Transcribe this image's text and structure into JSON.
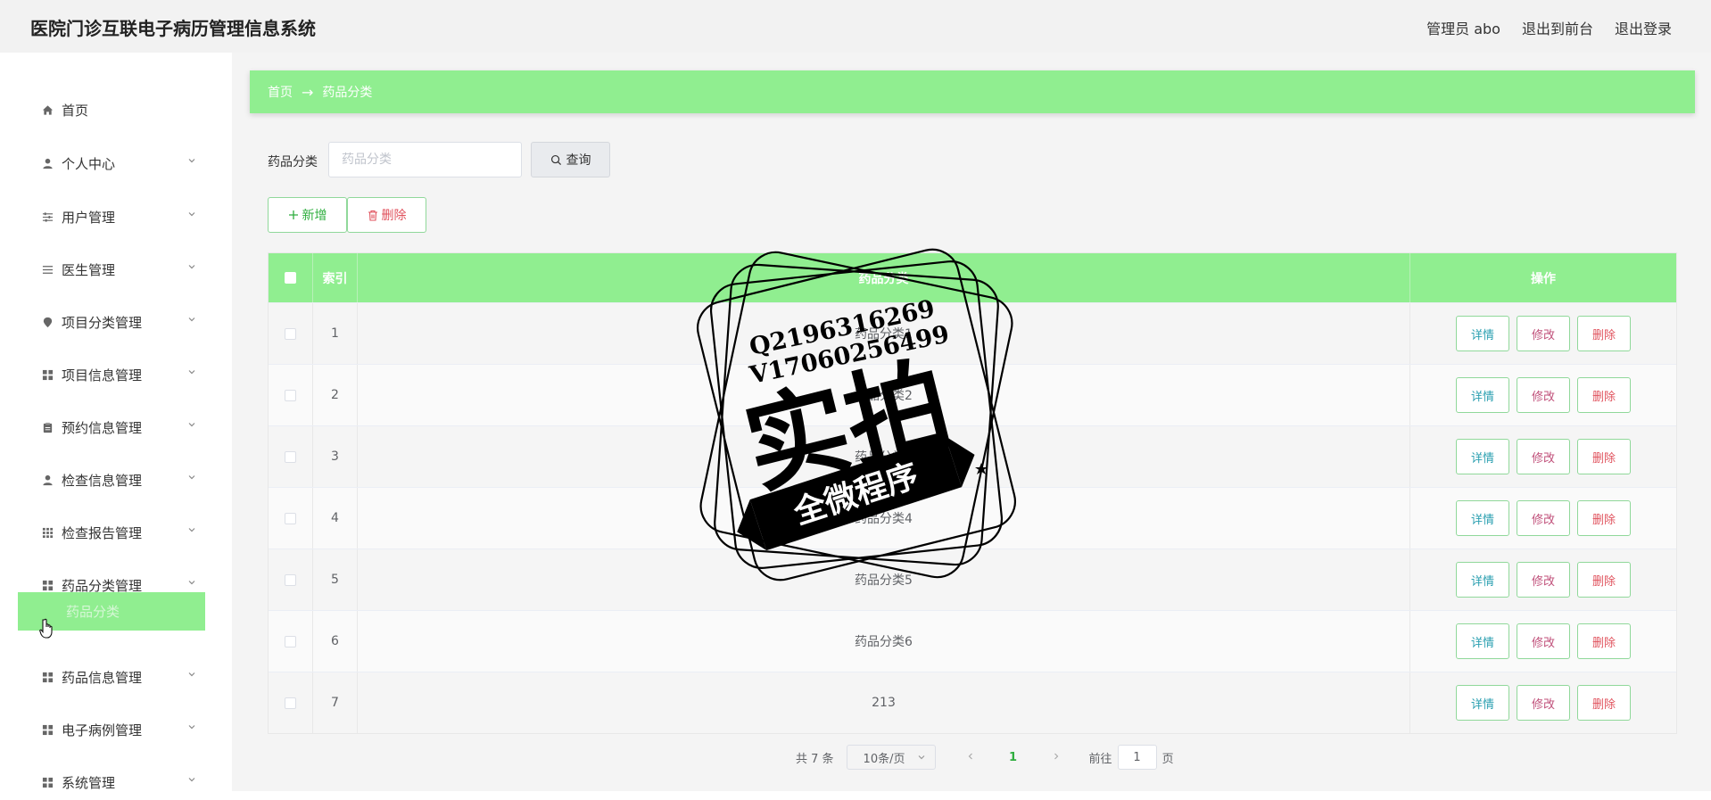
{
  "header": {
    "title": "医院门诊互联电子病历管理信息系统",
    "user": "管理员 abo",
    "front_link": "退出到前台",
    "logout": "退出登录"
  },
  "sidebar": {
    "items": [
      {
        "label": "首页",
        "icon": "home-icon"
      },
      {
        "label": "个人中心",
        "icon": "user-icon"
      },
      {
        "label": "用户管理",
        "icon": "sliders-icon"
      },
      {
        "label": "医生管理",
        "icon": "list-icon"
      },
      {
        "label": "项目分类管理",
        "icon": "location-pin-icon"
      },
      {
        "label": "项目信息管理",
        "icon": "grid-icon"
      },
      {
        "label": "预约信息管理",
        "icon": "clipboard-icon"
      },
      {
        "label": "检查信息管理",
        "icon": "user-icon"
      },
      {
        "label": "检查报告管理",
        "icon": "dots-grid-icon"
      },
      {
        "label": "药品分类管理",
        "icon": "grid-icon"
      },
      {
        "label": "药品信息管理",
        "icon": "grid-icon"
      },
      {
        "label": "电子病例管理",
        "icon": "grid-icon"
      },
      {
        "label": "系统管理",
        "icon": "grid-icon"
      }
    ],
    "active_sub": "药品分类"
  },
  "breadcrumb": {
    "home": "首页",
    "arrow": "→",
    "current": "药品分类"
  },
  "search": {
    "label": "药品分类",
    "placeholder": "药品分类",
    "button": "查询"
  },
  "actions": {
    "add": "新增",
    "delete": "删除"
  },
  "table": {
    "headers": {
      "index": "索引",
      "name": "药品分类",
      "ops": "操作"
    },
    "rows": [
      {
        "index": "1",
        "name": "药品分类1"
      },
      {
        "index": "2",
        "name": "药品分类2"
      },
      {
        "index": "3",
        "name": "药品分类3"
      },
      {
        "index": "4",
        "name": "药品分类4"
      },
      {
        "index": "5",
        "name": "药品分类5"
      },
      {
        "index": "6",
        "name": "药品分类6"
      },
      {
        "index": "7",
        "name": "213"
      }
    ],
    "op_labels": {
      "detail": "详情",
      "edit": "修改",
      "delete": "删除"
    }
  },
  "pagination": {
    "total": "共 7 条",
    "page_size": "10条/页",
    "current": "1",
    "goto_prefix": "前往",
    "goto_value": "1",
    "goto_suffix": "页"
  },
  "watermark": {
    "line1": "Q2196316269",
    "line2": "V17060256499",
    "main": "实拍",
    "sub": "全微程序"
  },
  "colors": {
    "accent": "#90ee90",
    "danger": "#e0525d",
    "info": "#2a9fb0"
  }
}
